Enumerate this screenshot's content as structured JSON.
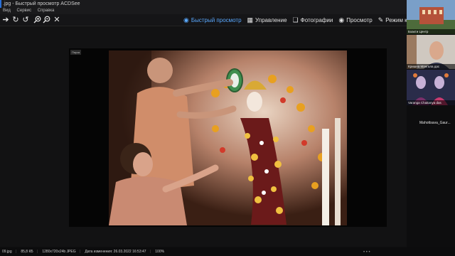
{
  "window": {
    "title": ".jpg - Быстрый просмотр ACDSee"
  },
  "menu": {
    "items": [
      "Вид",
      "Сервис",
      "Справка"
    ]
  },
  "toolbar": {
    "icons": [
      "arrow-right-icon",
      "rotate-ccw-icon",
      "rotate-cw-icon",
      "zoom-in-icon",
      "zoom-out-icon",
      "close-icon"
    ]
  },
  "modes": [
    {
      "label": "Быстрый просмотр",
      "icon": "eye-icon",
      "active": true
    },
    {
      "label": "Управление",
      "icon": "grid-icon",
      "active": false
    },
    {
      "label": "Фотографии",
      "icon": "photos-icon",
      "active": false
    },
    {
      "label": "Просмотр",
      "icon": "eye-icon",
      "active": false
    },
    {
      "label": "Режим коррект",
      "icon": "edit-icon",
      "active": false
    }
  ],
  "viewer": {
    "pause_badge": "Пауза"
  },
  "status": {
    "filename": "09.jpg",
    "filesize": "85,8 КБ",
    "dimensions": "1280x720x24b JPEG",
    "modified": "Дата изменения: 26.03.2022 16:53:47",
    "zoom": "100%"
  },
  "participants": [
    {
      "name": "Бхакти Центр"
    },
    {
      "name": "Кришна Мангала дас"
    },
    {
      "name": "Varanga Chaitanya das"
    },
    {
      "name": "Mahottsava_Gaur..."
    }
  ],
  "colors": {
    "accent": "#5aa9ff",
    "background": "#0f0f10"
  }
}
